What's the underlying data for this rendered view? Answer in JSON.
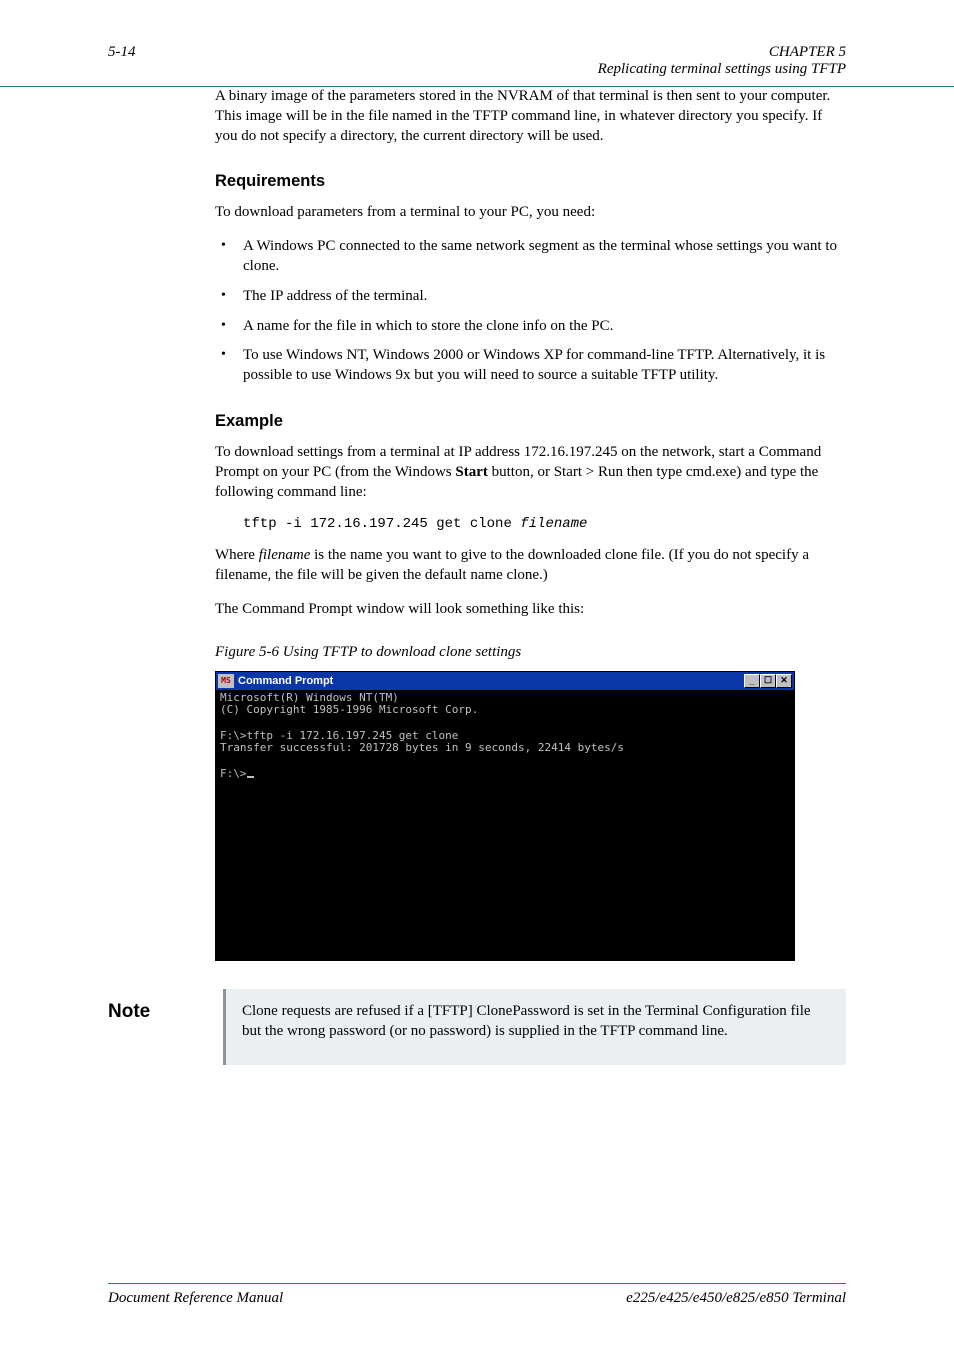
{
  "header": {
    "page_num": "5-14",
    "chapter_line1": "CHAPTER 5",
    "chapter_line2": "Replicating terminal settings using TFTP"
  },
  "intro_para": "A binary image of the parameters stored in the NVRAM of that terminal is then sent to your computer. This image will be in the file named in the TFTP command line, in whatever directory you specify. If you do not specify a directory, the current directory will be used.",
  "subheads": {
    "requirements": "Requirements",
    "example": "Example"
  },
  "requirements_intro": "To download parameters from a terminal to your PC, you need:",
  "requirements_bullets": [
    "A Windows PC connected to the same network segment as the terminal whose settings you want to clone.",
    "The IP address of the terminal.",
    "A name for the file in which to store the clone info on the PC.",
    "To use Windows NT, Windows 2000 or Windows XP for command-line TFTP. Alternatively, it is possible to use Windows 9x but you will need to source a suitable TFTP utility."
  ],
  "example_p1_prefix": "To download settings from a terminal at IP address 172.16.197.245 on the network, start a Command Prompt on your PC (from the Windows ",
  "example_p1_bold": "Start",
  "example_p1_suffix": " button, or Start > Run then type cmd.exe) and type the following command line:",
  "example_cmd": {
    "prefix": "tftp -i 172.16.197.245 get clone ",
    "var": "filename"
  },
  "example_p2_prefix": "Where ",
  "example_p2_var": "filename",
  "example_p2_suffix": " is the name you want to give to the downloaded clone file. (If you do not specify a filename, the file will be given the default name clone.)",
  "example_p3": "The Command Prompt window will look something like this:",
  "figure_caption": "Figure 5-6 Using TFTP to download clone settings",
  "cmdwin": {
    "icon_text": "MS\nDOS",
    "title": "Command Prompt",
    "btn_min": "_",
    "btn_max": "☐",
    "btn_close": "✕",
    "line1": "Microsoft(R) Windows NT(TM)",
    "line2": "(C) Copyright 1985-1996 Microsoft Corp.",
    "blank": "",
    "line3": "F:\\>tftp -i 172.16.197.245 get clone",
    "line4": "Transfer successful: 201728 bytes in 9 seconds, 22414 bytes/s",
    "line5_prefix": "F:\\>"
  },
  "note": {
    "label": "Note",
    "text": "Clone requests are refused if a [TFTP] ClonePassword is set in the Terminal Configuration file but the wrong password (or no password) is supplied in the TFTP command line."
  },
  "footer": {
    "left": "Document Reference Manual",
    "right": "e225/e425/e450/e825/e850 Terminal"
  }
}
